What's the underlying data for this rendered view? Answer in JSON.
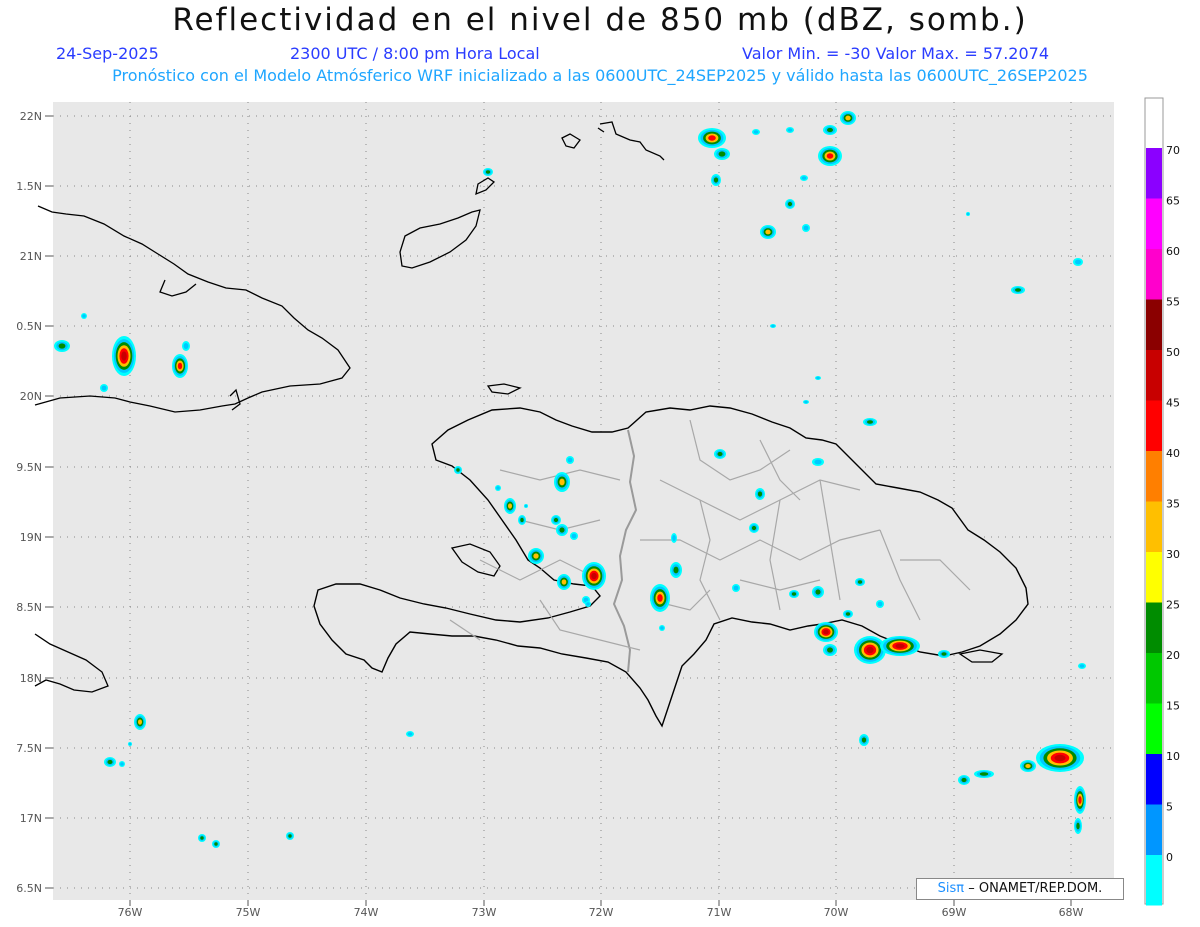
{
  "header": {
    "title": "Reflectividad en el nivel de 850 mb (dBZ, somb.)",
    "date": "24-Sep-2025",
    "time": "2300 UTC / 8:00 pm Hora Local",
    "minmax": "Valor Min. = -30  Valor Max. = 57.2074",
    "forecast": "Pronóstico con el Modelo Atmósferico WRF inicializado a las 0600UTC_24SEP2025 y válido hasta las  0600UTC_26SEP2025"
  },
  "axes": {
    "lat_labels": [
      "22N",
      "1.5N",
      "21N",
      "0.5N",
      "20N",
      "9.5N",
      "19N",
      "8.5N",
      "18N",
      "7.5N",
      "17N",
      "6.5N"
    ],
    "lon_labels": [
      "76W",
      "75W",
      "74W",
      "73W",
      "72W",
      "71W",
      "70W",
      "69W",
      "68W"
    ]
  },
  "colorbar": {
    "labels": [
      "70",
      "65",
      "60",
      "55",
      "50",
      "45",
      "40",
      "35",
      "30",
      "25",
      "20",
      "15",
      "10",
      "5",
      "0"
    ],
    "colors": [
      "#8b00ff",
      "#ff00ff",
      "#ff00cc",
      "#8b0000",
      "#c80000",
      "#ff0000",
      "#ff7f00",
      "#ffbf00",
      "#ffff00",
      "#008c00",
      "#00c800",
      "#00ff00",
      "#0000ff",
      "#0096ff",
      "#00ffff"
    ]
  },
  "credit": {
    "brand": "Sisπ",
    "text": "– ONAMET/REP.DOM."
  },
  "colors": {
    "ocean": "#e8e8e8",
    "coast": "#000000",
    "borders": "#9a9a9a",
    "grid": "#888888"
  }
}
